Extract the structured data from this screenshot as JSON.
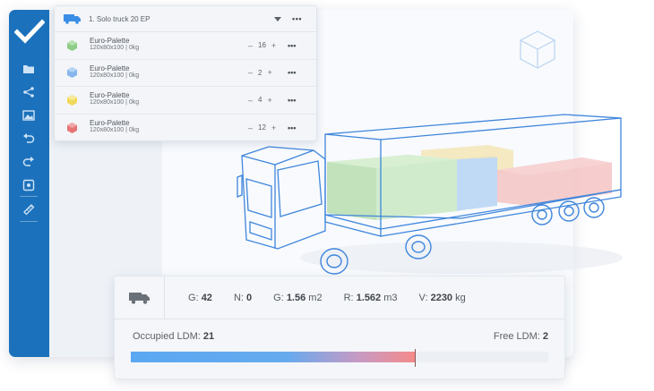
{
  "vehicle": {
    "name": "1. Solo truck 20 EP"
  },
  "cargo_items": [
    {
      "name": "Euro-Palette",
      "dims": "120x80x100 | 0kg",
      "qty": "16",
      "color": "#9ed39a"
    },
    {
      "name": "Euro-Palette",
      "dims": "120x80x100 | 0kg",
      "qty": "2",
      "color": "#9cc4ef"
    },
    {
      "name": "Euro-Palette",
      "dims": "120x80x100 | 0kg",
      "qty": "4",
      "color": "#f6e27a"
    },
    {
      "name": "Euro-Palette",
      "dims": "120x80x100 | 0kg",
      "qty": "12",
      "color": "#ee8f8f"
    }
  ],
  "controls": {
    "minus": "–",
    "plus": "+",
    "more": "•••"
  },
  "sidebar": {
    "items": [
      {
        "icon": "folder-icon"
      },
      {
        "icon": "share-icon"
      },
      {
        "icon": "image-icon"
      },
      {
        "icon": "undo-icon"
      },
      {
        "icon": "redo-icon"
      },
      {
        "icon": "center-view-icon"
      },
      {
        "icon": "ruler-icon"
      }
    ]
  },
  "stats": {
    "g_label": "G:",
    "g_value": "42",
    "n_label": "N:",
    "n_value": "0",
    "area_label": "G:",
    "area_value": "1.56",
    "area_unit": "m2",
    "r_label": "R:",
    "r_value": "1.562",
    "r_unit": "m3",
    "v_label": "V:",
    "v_value": "2230",
    "v_unit": "kg"
  },
  "ldm": {
    "occupied_label": "Occupied LDM:",
    "occupied_value": "21",
    "free_label": "Free LDM:",
    "free_value": "2",
    "fill_fraction": 0.68
  },
  "colors": {
    "brand": "#1b71bb",
    "wireframe": "#3f86dc"
  }
}
